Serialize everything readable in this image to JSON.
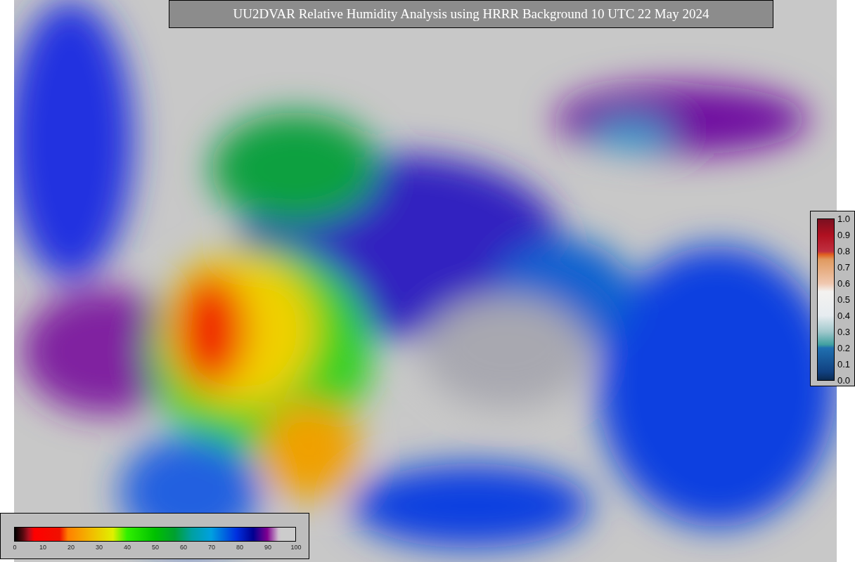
{
  "title": "UU2DVAR Relative Humidity Analysis using HRRR Background 10 UTC 22 May 2024",
  "humidity_colorbar": {
    "ticks": [
      "0",
      "10",
      "20",
      "30",
      "40",
      "50",
      "60",
      "70",
      "80",
      "90",
      "100"
    ]
  },
  "observation_colorbar": {
    "ticks": [
      "1.0",
      "0.9",
      "0.8",
      "0.7",
      "0.6",
      "0.5",
      "0.4",
      "0.3",
      "0.2",
      "0.1",
      "0.0"
    ]
  }
}
